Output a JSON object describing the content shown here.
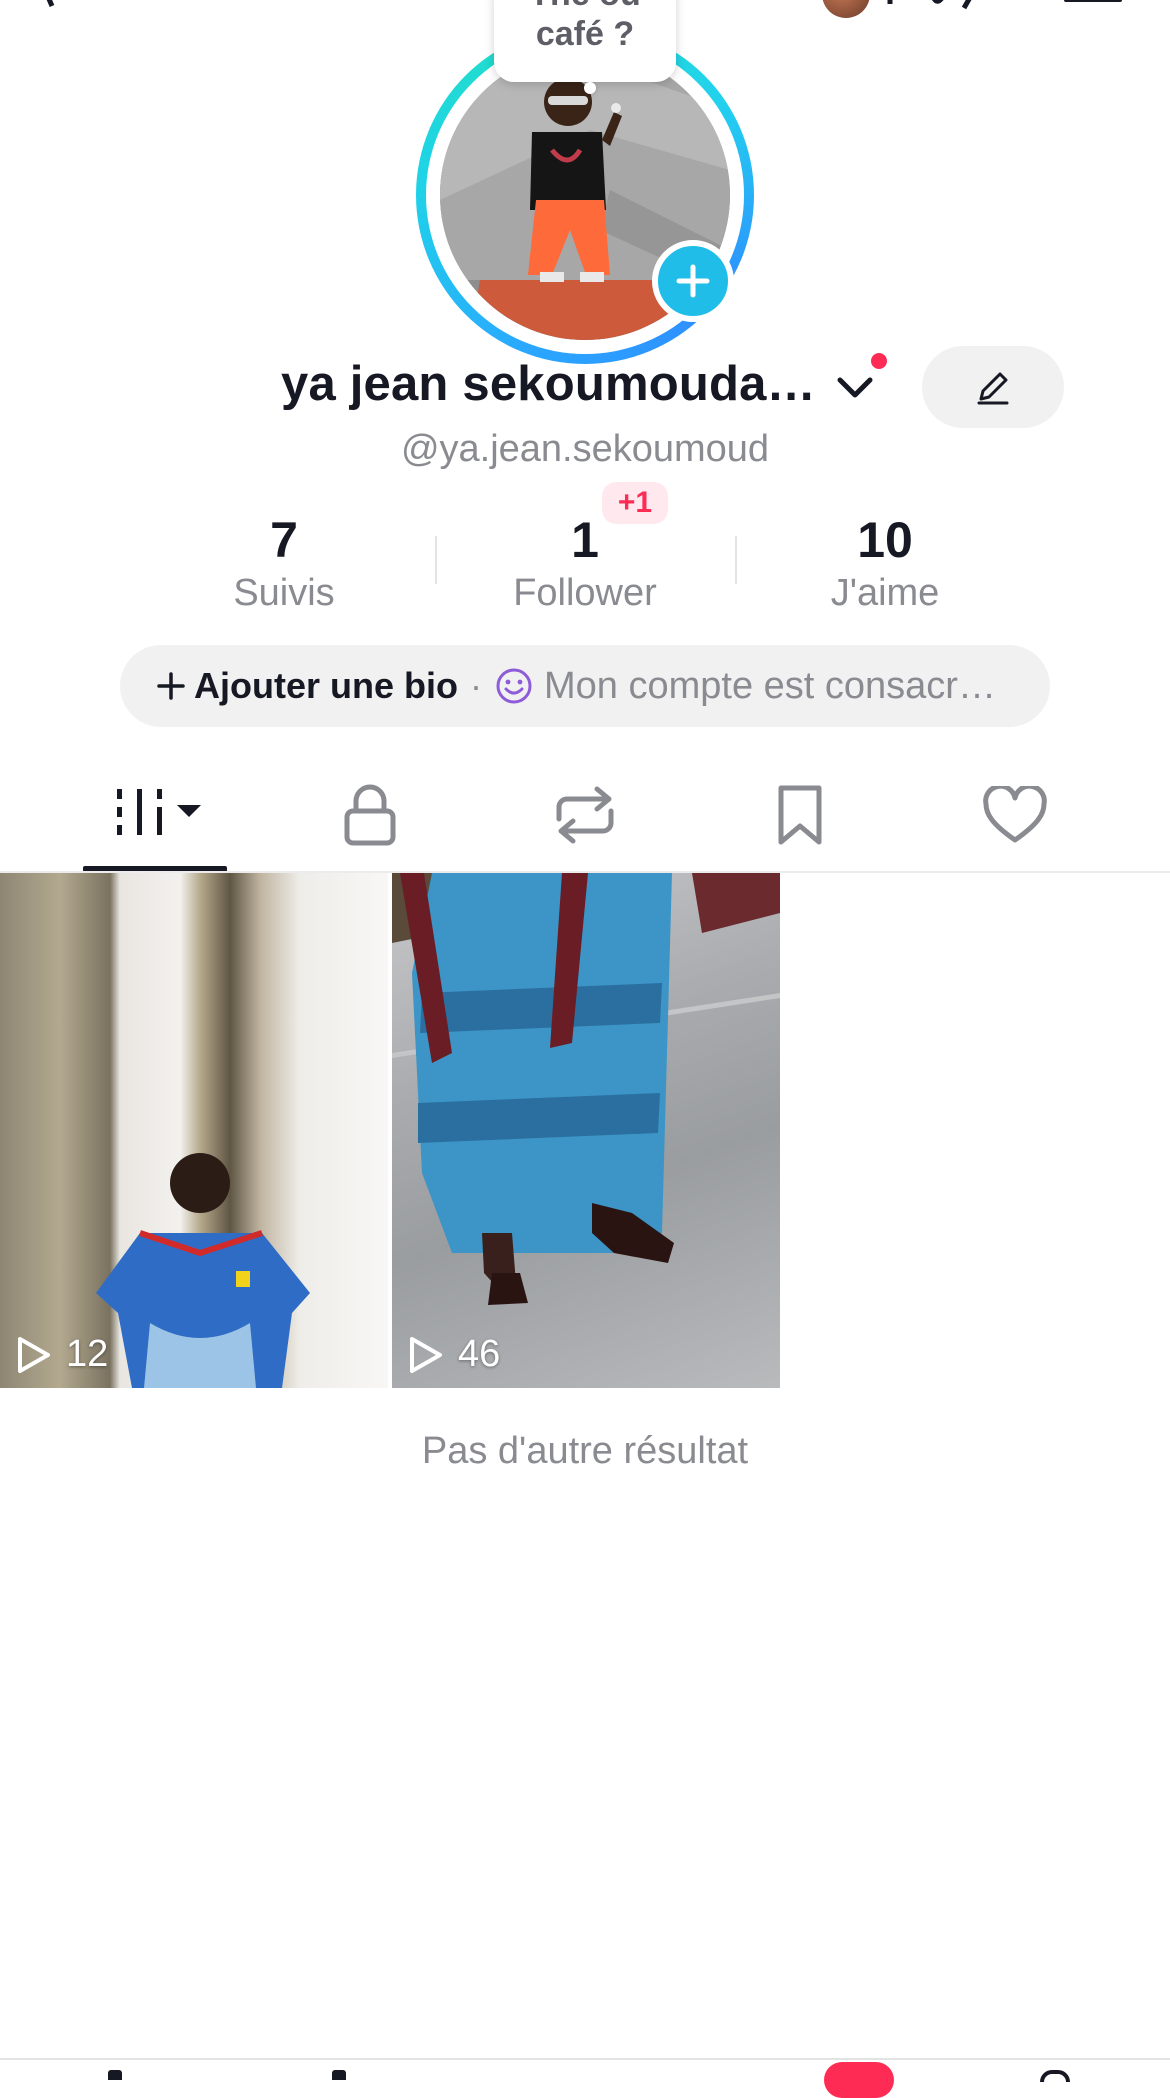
{
  "profile": {
    "display_name": "ya jean sekoumouda…",
    "handle": "@ya.jean.sekoumoud",
    "avatar_bubble_line1": "Thé ou",
    "avatar_bubble_line2": "café ?"
  },
  "stats": {
    "following": {
      "count": "7",
      "label": "Suivis"
    },
    "followers": {
      "count": "1",
      "label": "Follower",
      "badge": "+1"
    },
    "likes": {
      "count": "10",
      "label": "J'aime"
    }
  },
  "bio": {
    "add_label": "Ajouter une bio",
    "separator": "·",
    "preview": "Mon compte est consacr…"
  },
  "tabs": [
    {
      "name": "videos",
      "icon": "grid-icon",
      "active": true
    },
    {
      "name": "private",
      "icon": "lock-icon"
    },
    {
      "name": "reposts",
      "icon": "repost-icon"
    },
    {
      "name": "favorites",
      "icon": "bookmark-icon"
    },
    {
      "name": "liked",
      "icon": "heart-icon"
    }
  ],
  "videos": [
    {
      "views": "12"
    },
    {
      "views": "46"
    }
  ],
  "end_message": "Pas d'autre résultat",
  "colors": {
    "accent_red": "#fe2c55",
    "ring_blue": "#2aa7ff",
    "ring_teal": "#20e0c7",
    "plus_blue": "#20bde9",
    "text_primary": "#161823",
    "text_secondary": "#8a8b91"
  }
}
